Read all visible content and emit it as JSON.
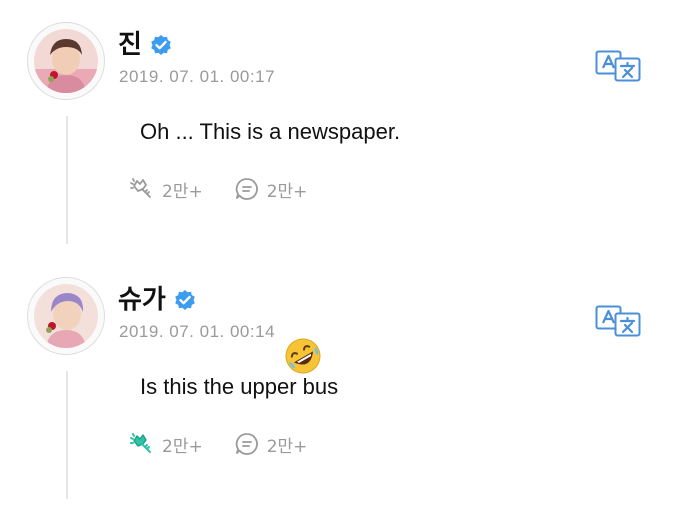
{
  "posts": [
    {
      "author": "진",
      "timestamp": "2019. 07. 01. 00:17",
      "text": "Oh ... This is a newspaper.",
      "cheer_count": "2만+",
      "comment_count": "2만+",
      "cheered": false,
      "avatar_icon": "profile-photo",
      "translate_icon": "translate-icon"
    },
    {
      "author": "슈가",
      "timestamp": "2019. 07. 01. 00:14",
      "text": "Is this the upper bus",
      "cheer_count": "2만+",
      "comment_count": "2만+",
      "cheered": true,
      "avatar_icon": "profile-photo",
      "translate_icon": "translate-icon",
      "reaction_emoji": "rolling-on-the-floor-laughing-emoji"
    }
  ],
  "colors": {
    "verified": "#3b9cf0",
    "cheer_active": "#2ec4a6",
    "icon_gray": "#9a9a9a",
    "translate_blue": "#4a8fd8",
    "thread_line": "#e6e6e6"
  }
}
